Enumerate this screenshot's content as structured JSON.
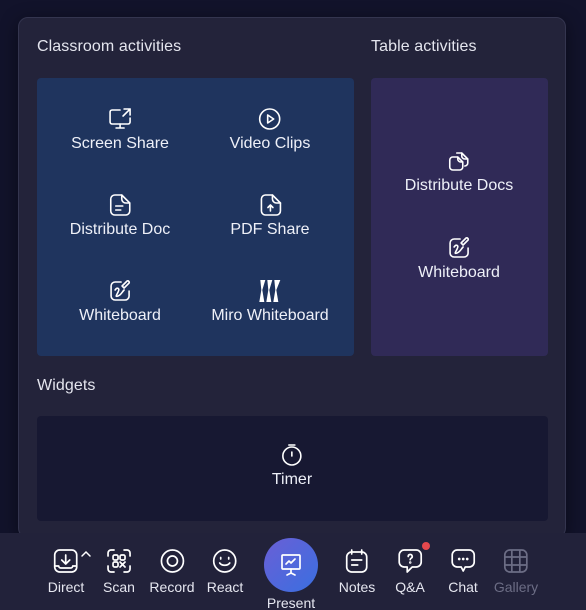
{
  "panel": {
    "classroom": {
      "title": "Classroom activities",
      "items": [
        {
          "label": "Screen Share",
          "icon": "screen-share-icon"
        },
        {
          "label": "Video Clips",
          "icon": "play-circle-icon"
        },
        {
          "label": "Distribute Doc",
          "icon": "document-icon"
        },
        {
          "label": "PDF Share",
          "icon": "pdf-upload-icon"
        },
        {
          "label": "Whiteboard",
          "icon": "whiteboard-icon"
        },
        {
          "label": "Miro Whiteboard",
          "icon": "miro-logo-icon"
        }
      ]
    },
    "table": {
      "title": "Table activities",
      "items": [
        {
          "label": "Distribute Docs",
          "icon": "documents-stack-icon"
        },
        {
          "label": "Whiteboard",
          "icon": "whiteboard-icon"
        }
      ]
    },
    "widgets": {
      "title": "Widgets",
      "items": [
        {
          "label": "Timer",
          "icon": "stopwatch-icon"
        }
      ]
    }
  },
  "toolbar": {
    "items": [
      {
        "label": "Direct",
        "icon": "download-tray-icon",
        "has_caret": true
      },
      {
        "label": "Scan",
        "icon": "qr-scan-icon"
      },
      {
        "label": "Record",
        "icon": "record-icon"
      },
      {
        "label": "React",
        "icon": "smiley-icon"
      },
      {
        "label": "Present",
        "icon": "presentation-icon",
        "active": true
      },
      {
        "label": "Notes",
        "icon": "notes-icon"
      },
      {
        "label": "Q&A",
        "icon": "question-bubble-icon",
        "has_notification": true
      },
      {
        "label": "Chat",
        "icon": "chat-bubble-icon"
      },
      {
        "label": "Gallery",
        "icon": "grid-icon",
        "disabled": true
      }
    ]
  },
  "colors": {
    "background": "#12132b",
    "panel": "#23233a",
    "classroom_tile_bg": "#1f345e",
    "table_tile_bg": "#302a57",
    "widgets_tile_bg": "#171832",
    "present_gradient_start": "#6a5fd6",
    "present_gradient_end": "#3a6fe0",
    "notification": "#e5484d"
  }
}
